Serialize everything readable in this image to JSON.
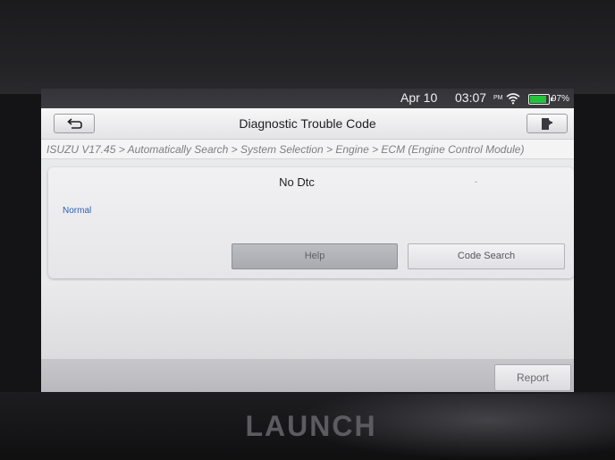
{
  "status_bar": {
    "date": "Apr 10",
    "time": "03:07",
    "ampm": "PM",
    "battery": "97%",
    "icons": [
      "wifi-icon",
      "battery-icon"
    ],
    "battery_color": "#23c43a"
  },
  "header": {
    "title": "Diagnostic Trouble Code",
    "back_icon": "back-arrow-icon",
    "exit_icon": "exit-door-icon"
  },
  "breadcrumb": "ISUZU V17.45 > Automatically Search > System Selection > Engine > ECM (Engine Control Module)",
  "dtc": {
    "heading": "No Dtc",
    "dash": "-",
    "status": "Normal",
    "status_color": "#2b5fb5"
  },
  "actions": {
    "help": "Help",
    "code_search": "Code Search"
  },
  "footer": {
    "report": "Report"
  },
  "device": {
    "brand": "LAUNCH"
  }
}
